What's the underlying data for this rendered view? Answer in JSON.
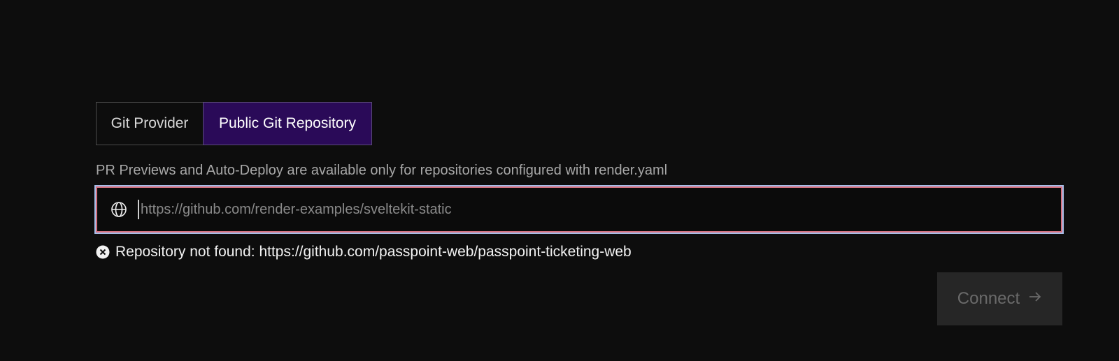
{
  "source_tabs": {
    "items": [
      {
        "label": "Git Provider",
        "active": false
      },
      {
        "label": "Public Git Repository",
        "active": true
      }
    ]
  },
  "hint_text": "PR Previews and Auto-Deploy are available only for repositories configured with render.yaml",
  "repo_input": {
    "value": "",
    "placeholder": "https://github.com/render-examples/sveltekit-static",
    "icon": "globe-icon"
  },
  "error": {
    "icon": "error-x-circle-icon",
    "message": "Repository not found: https://github.com/passpoint-web/passpoint-ticketing-web"
  },
  "connect_button": {
    "label": "Connect",
    "icon": "arrow-right-icon",
    "disabled": true
  },
  "colors": {
    "background": "#0d0d0d",
    "active_tab": "#2a0a58",
    "input_border_error": "#d6717f",
    "focus_ring": "#a8bde8",
    "button_disabled_bg": "#262626"
  }
}
